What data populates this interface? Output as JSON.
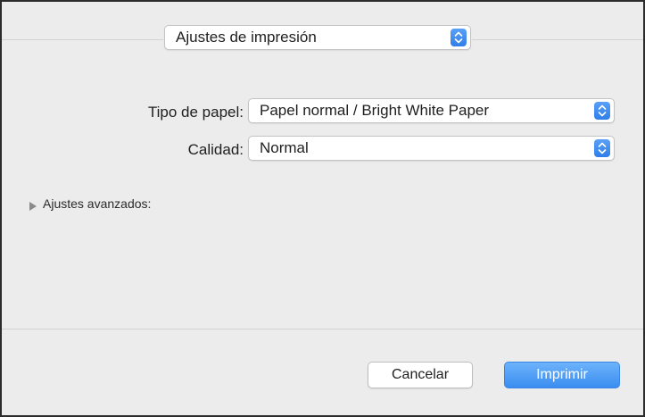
{
  "preset_menu": {
    "selected": "Ajustes de impresión"
  },
  "paper_type": {
    "label": "Tipo de papel:",
    "selected": "Papel normal / Bright White Paper"
  },
  "quality": {
    "label": "Calidad:",
    "selected": "Normal"
  },
  "advanced": {
    "label": "Ajustes avanzados:",
    "expanded": false
  },
  "buttons": {
    "cancel": "Cancelar",
    "print": "Imprimir"
  },
  "colors": {
    "accent": "#3a8df0",
    "background": "#ececec"
  }
}
